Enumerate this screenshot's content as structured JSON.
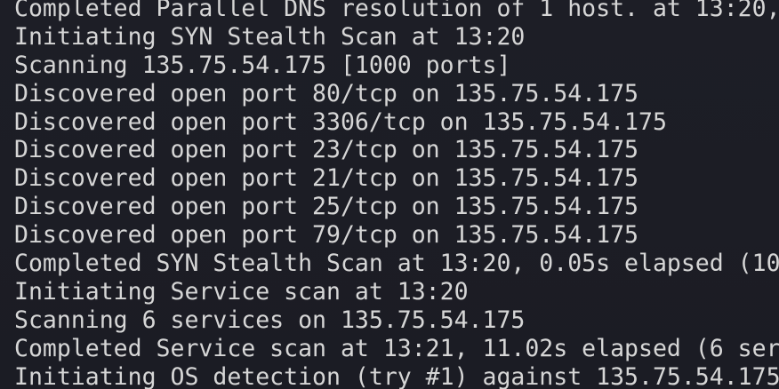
{
  "terminal": {
    "lines": [
      "Completed Parallel DNS resolution of 1 host. at 13:20,",
      "Initiating SYN Stealth Scan at 13:20",
      "Scanning 135.75.54.175 [1000 ports]",
      "Discovered open port 80/tcp on 135.75.54.175",
      "Discovered open port 3306/tcp on 135.75.54.175",
      "Discovered open port 23/tcp on 135.75.54.175",
      "Discovered open port 21/tcp on 135.75.54.175",
      "Discovered open port 25/tcp on 135.75.54.175",
      "Discovered open port 79/tcp on 135.75.54.175",
      "Completed SYN Stealth Scan at 13:20, 0.05s elapsed (10",
      "Initiating Service scan at 13:20",
      "Scanning 6 services on 135.75.54.175",
      "Completed Service scan at 13:21, 11.02s elapsed (6 ser",
      "Initiating OS detection (try #1) against 135.75.54.175"
    ]
  },
  "colors": {
    "background": "#1c1d25",
    "text": "#d6d6d6"
  }
}
